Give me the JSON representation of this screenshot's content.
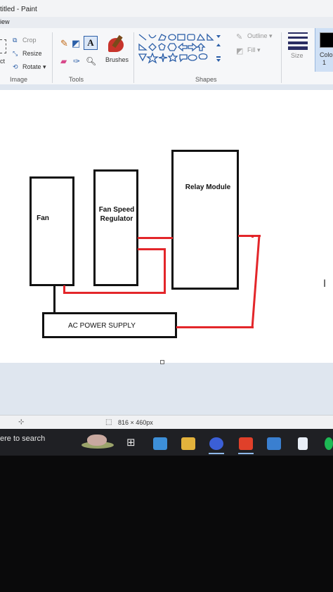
{
  "window": {
    "title": "titled - Paint",
    "menu_tab": "iew"
  },
  "ribbon": {
    "image_group": {
      "label": "Image",
      "crop": "Crop",
      "resize": "Resize",
      "rotate": "Rotate ▾",
      "select_partial": "ct"
    },
    "tools_group": {
      "label": "Tools",
      "text_tool": "A"
    },
    "brushes": {
      "label": "Brushes"
    },
    "shapes_group": {
      "label": "Shapes",
      "outline": "Outline ▾",
      "fill": "Fill ▾"
    },
    "size": {
      "label": "Size"
    },
    "color": {
      "label": "Colo",
      "sub": "1"
    }
  },
  "diagram": {
    "fan": "Fan",
    "fan_speed_regulator": "Fan Speed\nRegulator",
    "relay_module": "Relay Module",
    "ac_power_supply": "AC POWER SUPPLY"
  },
  "statusbar": {
    "dimensions": "816 × 460px"
  },
  "taskbar": {
    "search": "ere to search"
  },
  "colors": {
    "wire": "#e3262a",
    "canvas": "#ffffff",
    "workspace": "#dfe6ef"
  }
}
